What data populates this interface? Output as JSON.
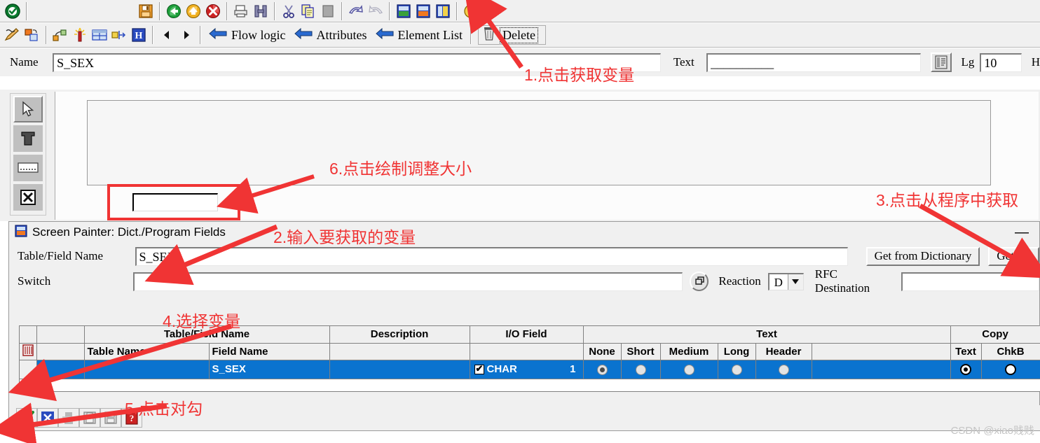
{
  "toolbar_top": {
    "buttons": [
      {
        "name": "enter-check-icon",
        "title": "Enter"
      },
      {
        "name": "save-icon",
        "title": "Save"
      },
      {
        "name": "back-icon",
        "title": "Back"
      },
      {
        "name": "exit-icon",
        "title": "Exit"
      },
      {
        "name": "cancel-icon",
        "title": "Cancel"
      },
      {
        "name": "print-icon",
        "title": "Print"
      },
      {
        "name": "find-icon",
        "title": "Find"
      },
      {
        "name": "cut-icon",
        "title": "Cut"
      },
      {
        "name": "copy-icon",
        "title": "Copy"
      },
      {
        "name": "paste-icon",
        "title": "Paste"
      },
      {
        "name": "undo-icon",
        "title": "Undo"
      },
      {
        "name": "redo-icon",
        "title": "Redo"
      },
      {
        "name": "layout-green-icon",
        "title": "Layout"
      },
      {
        "name": "layout-orange-icon",
        "title": "Dict./Program Fields"
      },
      {
        "name": "layout-yellow-icon",
        "title": "Element list"
      },
      {
        "name": "help-icon",
        "title": "Help"
      }
    ]
  },
  "toolbar_second": {
    "buttons": [
      {
        "name": "edit-pencil-icon"
      },
      {
        "name": "copy-object-icon"
      },
      {
        "name": "group-icon"
      },
      {
        "name": "wizard-icon"
      },
      {
        "name": "table-control-icon"
      },
      {
        "name": "align-icon"
      },
      {
        "name": "info-icon"
      },
      {
        "name": "prev-icon"
      },
      {
        "name": "next-icon"
      }
    ],
    "flow_logic_label": "Flow logic",
    "attributes_label": "Attributes",
    "element_list_label": "Element List",
    "delete_label": "Delete"
  },
  "name_row": {
    "name_label": "Name",
    "name_value": "S_SEX",
    "text_label": "Text",
    "text_value": "__________",
    "lg_label": "Lg",
    "lg_value": "10",
    "h_label": "H"
  },
  "left_tools": [
    {
      "name": "pointer-tool-icon",
      "selected": true
    },
    {
      "name": "text-tool-icon",
      "selected": false
    },
    {
      "name": "input-field-tool-icon",
      "selected": false
    },
    {
      "name": "checkbox-tool-icon",
      "selected": false
    }
  ],
  "dialog": {
    "title": "Screen Painter: Dict./Program Fields",
    "minimize_label": "—",
    "table_field_label": "Table/Field Name",
    "table_field_value": "S_SEX",
    "switch_label": "Switch",
    "switch_value": "",
    "get_from_dictionary_label": "Get from Dictionary",
    "get_from_program_label": "Get fro",
    "reaction_label": "Reaction",
    "reaction_value": "D",
    "rfc_destination_label": "RFC Destination",
    "rfc_destination_value": ""
  },
  "table": {
    "group_headers": {
      "table_field_name": "Table/Field Name",
      "description": "Description",
      "io_field": "I/O Field",
      "text": "Text",
      "copy": "Copy"
    },
    "sub_headers": {
      "table_name": "Table Name",
      "field_name": "Field Name",
      "none": "None",
      "short": "Short",
      "medium": "Medium",
      "long": "Long",
      "header": "Header",
      "copy_text": "Text",
      "copy_chkbox": "ChkB"
    },
    "rows": [
      {
        "table_name": "",
        "field_name": "S_SEX",
        "description": "",
        "io_type": "CHAR",
        "io_len": "1",
        "text_selected": "None",
        "copy_selected": "Text"
      }
    ]
  },
  "bottom_toolbar": {
    "buttons": [
      {
        "name": "confirm-check-icon"
      },
      {
        "name": "cancel-x-icon"
      },
      {
        "name": "print-gray-icon"
      },
      {
        "name": "save-gray-icon"
      },
      {
        "name": "save-as-gray-icon"
      },
      {
        "name": "help-red-icon"
      }
    ]
  },
  "annotations": [
    {
      "id": 1,
      "text": "1.点击获取变量"
    },
    {
      "id": 2,
      "text": "2.输入要获取的变量"
    },
    {
      "id": 3,
      "text": "3.点击从程序中获取"
    },
    {
      "id": 4,
      "text": "4.选择变量"
    },
    {
      "id": 5,
      "text": "5.点击对勾"
    },
    {
      "id": 6,
      "text": "6.点击绘制调整大小"
    }
  ],
  "watermark": "CSDN @xiao贱贱",
  "colors": {
    "annotation": "#f03434",
    "selection": "#0a73cf",
    "chrome": "#f0f0f0"
  }
}
